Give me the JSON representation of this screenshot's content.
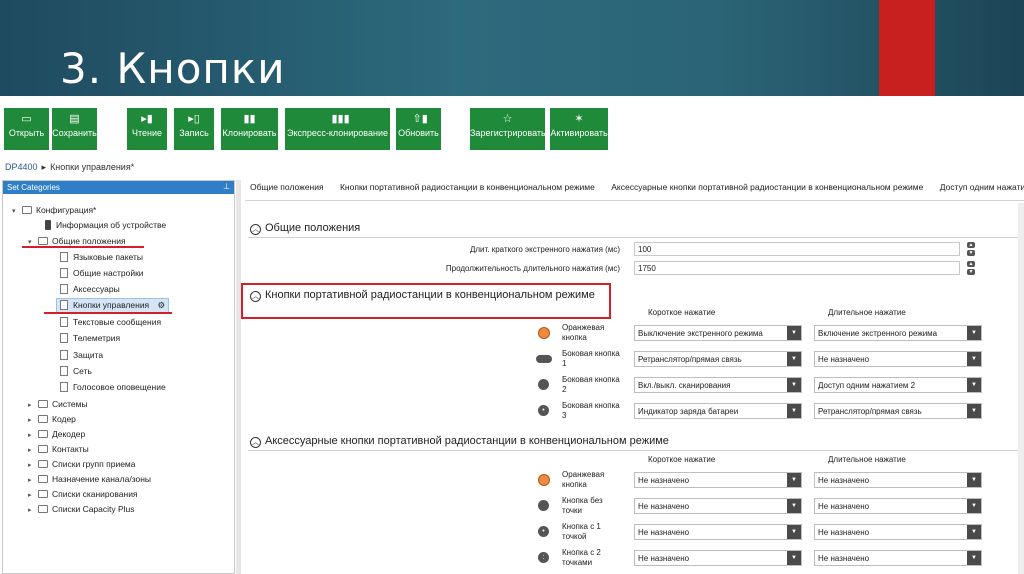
{
  "slide": {
    "title": "3. Кнопки"
  },
  "toolbar": {
    "open": "Открыть",
    "save": "Сохранить",
    "read": "Чтение",
    "write": "Запись",
    "clone": "Клонировать",
    "express_clone": "Экспресс-клонирование",
    "update": "Обновить",
    "register": "Зарегистрировать",
    "activate": "Активировать"
  },
  "breadcrumb": {
    "root": "DP4400",
    "current": "Кнопки управления*"
  },
  "left_panel": {
    "header": "Set Categories",
    "tree": {
      "config": "Конфигурация*",
      "device_info": "Информация об устройстве",
      "general": "Общие положения",
      "language": "Языковые пакеты",
      "general_settings": "Общие настройки",
      "accessories": "Аксессуары",
      "buttons": "Кнопки управления",
      "text_messages": "Текстовые сообщения",
      "telemetry": "Телеметрия",
      "protection": "Защита",
      "network": "Сеть",
      "voice": "Голосовое оповещение",
      "systems": "Системы",
      "coder": "Кодер",
      "decoder": "Декодер",
      "contacts": "Контакты",
      "rx_groups": "Списки групп приема",
      "channels": "Назначение канала/зоны",
      "scan_lists": "Списки сканирования",
      "capacity": "Списки Capacity Plus"
    }
  },
  "tabs": [
    "Общие положения",
    "Кнопки портативной радиостанции в конвенциональном режиме",
    "Аксессуарные кнопки портативной радиостанции в конвенциональном режиме",
    "Доступ одним нажатием"
  ],
  "general": {
    "title": "Общие положения",
    "short_label": "Длит. краткого экстренного нажатия (мс)",
    "short_value": "100",
    "long_label": "Продолжительность длительного нажатия (мс)",
    "long_value": "1750"
  },
  "portable": {
    "title": "Кнопки портативной радиостанции в конвенциональном режиме",
    "col_short": "Короткое нажатие",
    "col_long": "Длительное нажатие",
    "rows": [
      {
        "label": "Оранжевая кнопка",
        "short": "Выключение экстренного режима",
        "long": "Включение экстренного режима"
      },
      {
        "label": "Боковая кнопка 1",
        "short": "Ретранслятор/прямая связь",
        "long": "Не назначено"
      },
      {
        "label": "Боковая кнопка 2",
        "short": "Вкл./выкл. сканирования",
        "long": "Доступ одним нажатием 2"
      },
      {
        "label": "Боковая кнопка 3",
        "short": "Индикатор заряда батареи",
        "long": "Ретранслятор/прямая связь"
      }
    ]
  },
  "accessory": {
    "title": "Аксессуарные кнопки портативной радиостанции в конвенциональном режиме",
    "col_short": "Короткое нажатие",
    "col_long": "Длительное нажатие",
    "rows": [
      {
        "label": "Оранжевая кнопка",
        "short": "Не назначено",
        "long": "Не назначено"
      },
      {
        "label": "Кнопка без точки",
        "short": "Не назначено",
        "long": "Не назначено"
      },
      {
        "label": "Кнопка с 1 точкой",
        "short": "Не назначено",
        "long": "Не назначено"
      },
      {
        "label": "Кнопка с 2 точками",
        "short": "Не назначено",
        "long": "Не назначено"
      }
    ]
  },
  "colors": {
    "toolbar_green": "#1f8a3a",
    "header_blue": "#2f7fc8",
    "highlight_red": "#d21f2a",
    "slide_teal": "#2c6a7d"
  }
}
